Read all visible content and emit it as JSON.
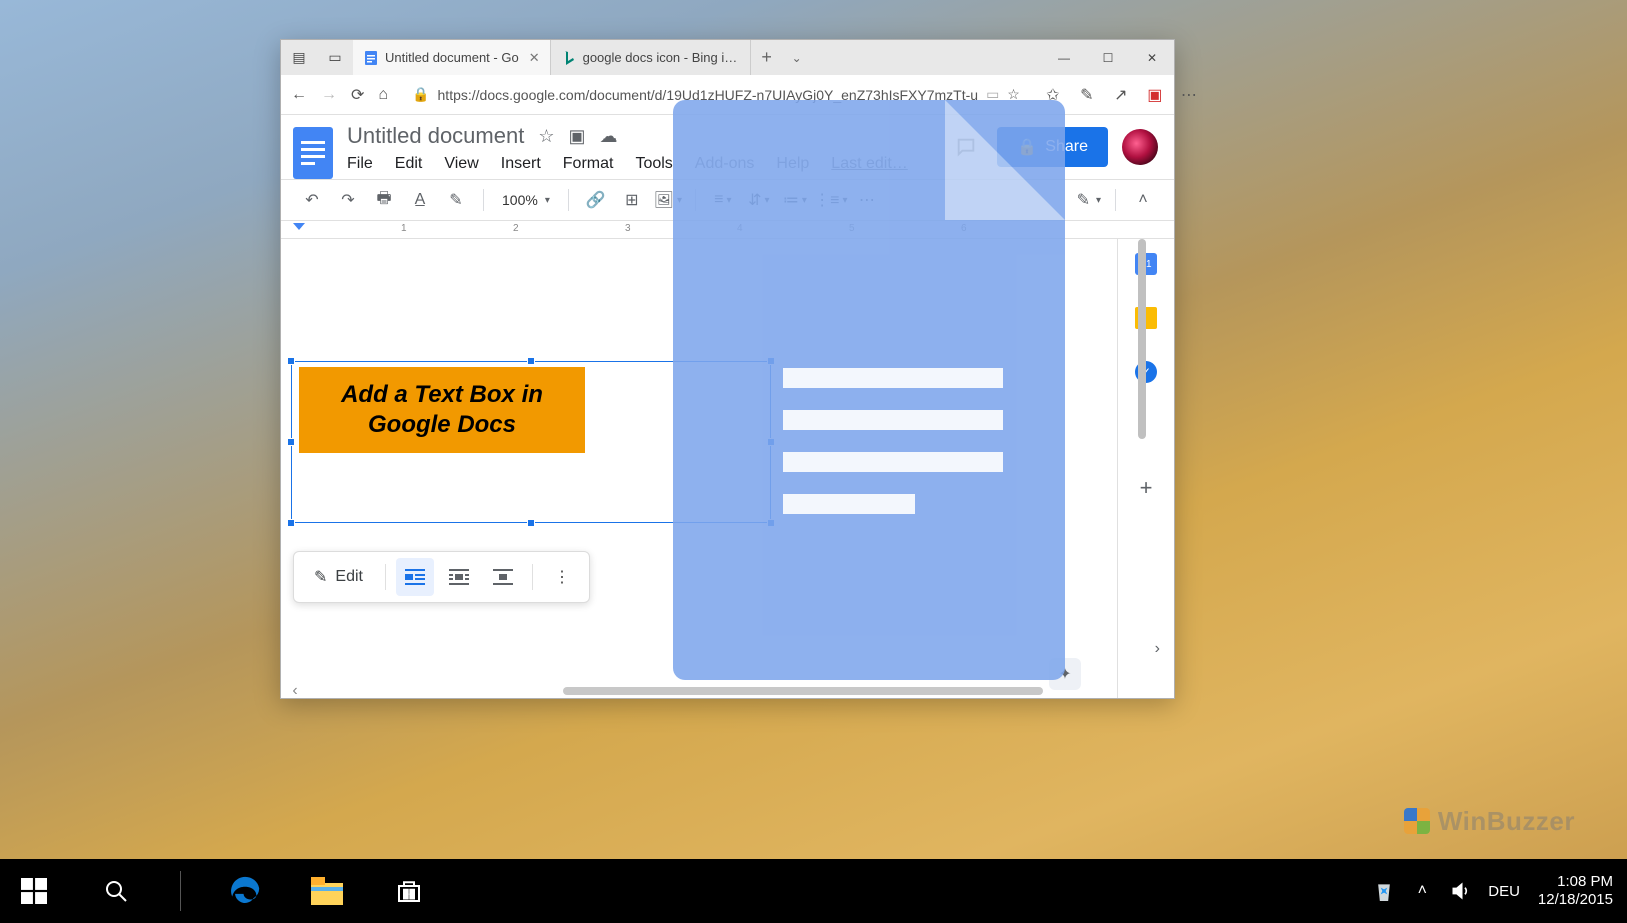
{
  "browser": {
    "tabs": [
      {
        "title": "Untitled document - Go",
        "active": true
      },
      {
        "title": "google docs icon - Bing ima",
        "active": false
      }
    ],
    "url": "https://docs.google.com/document/d/19Ud1zHUFZ-n7UIAyGj0Y_enZ73hIsFXY7mzTt-u"
  },
  "docs": {
    "title": "Untitled document",
    "menu": [
      "File",
      "Edit",
      "View",
      "Insert",
      "Format",
      "Tools",
      "Add-ons",
      "Help"
    ],
    "last_edit": "Last edit…",
    "share": "Share",
    "zoom": "100%",
    "textbox_text": "Add a Text Box in Google Docs",
    "img_toolbar_edit": "Edit",
    "ruler_marks": [
      "1",
      "2",
      "3",
      "4",
      "5",
      "6"
    ],
    "sidebar_calendar_day": "31"
  },
  "taskbar": {
    "language": "DEU",
    "time": "1:08 PM",
    "date": "12/18/2015"
  },
  "watermark": "WinBuzzer"
}
